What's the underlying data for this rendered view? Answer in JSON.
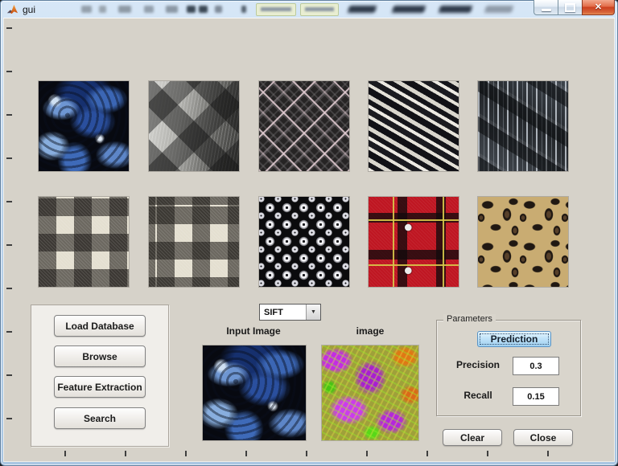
{
  "titlebar": {
    "app_title": "gui"
  },
  "window_controls": {
    "minimize_icon": "minimize-bar",
    "maximize_icon": "maximize-square",
    "close_icon": "✕"
  },
  "gallery": {
    "thumbnails": [
      {
        "id": 1,
        "description": "blue paisley fabric"
      },
      {
        "id": 2,
        "description": "gray-black argyle diamond weave"
      },
      {
        "id": 3,
        "description": "black-gray-pink diamond medallion print"
      },
      {
        "id": 4,
        "description": "black and white diagonal stripes"
      },
      {
        "id": 5,
        "description": "dark gray streaked weave"
      },
      {
        "id": 6,
        "description": "black and cream buffalo check"
      },
      {
        "id": 7,
        "description": "black and cream buffalo check"
      },
      {
        "id": 8,
        "description": "black fabric with white diamond dots"
      },
      {
        "id": 9,
        "description": "red-black tartan plaid with buttons"
      },
      {
        "id": 10,
        "description": "leopard print"
      }
    ]
  },
  "database_panel": {
    "buttons": [
      {
        "label": "Load Database"
      },
      {
        "label": "Browse"
      },
      {
        "label": "Feature Extraction"
      },
      {
        "label": "Search"
      }
    ]
  },
  "feature_dropdown": {
    "selected": "SIFT",
    "arrow_icon": "▼"
  },
  "query_section": {
    "input_image_label": "Input Image",
    "feature_image_label": "image",
    "input_image_description": "blue paisley fabric query image",
    "feature_image_description": "false-color feature visualization of query"
  },
  "parameters_panel": {
    "title": "Parameters",
    "prediction_button_label": "Prediction",
    "precision_label": "Precision",
    "precision_value": "0.3",
    "recall_label": "Recall",
    "recall_value": "0.15"
  },
  "action_buttons": {
    "clear_label": "Clear",
    "close_label": "Close"
  },
  "colors": {
    "figure_background": "#d6d2c9",
    "panel_background": "#f0eeea",
    "titlebar_glass": "#bcd4ec",
    "close_button_red": "#cb3f1e",
    "prediction_button_blue": "#c2e4f9"
  }
}
